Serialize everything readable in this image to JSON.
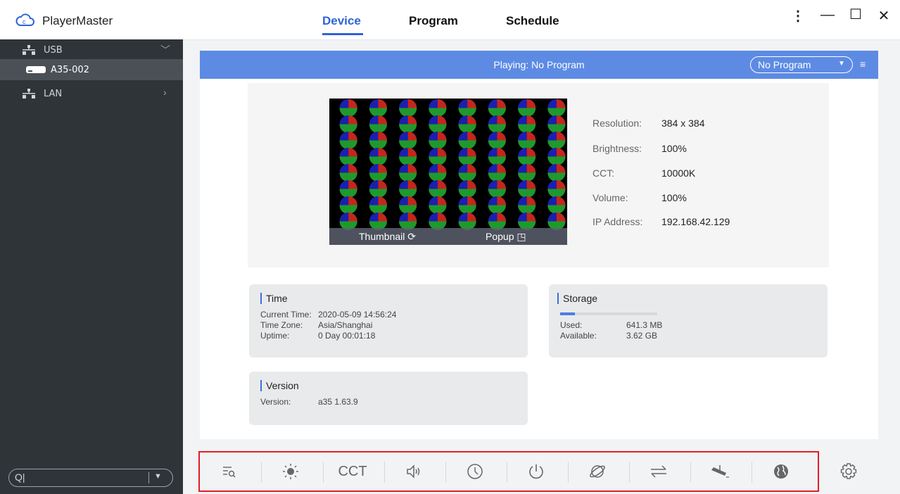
{
  "app": {
    "title": "PlayerMaster",
    "tabs": [
      {
        "label": "Device",
        "active": true
      },
      {
        "label": "Program",
        "active": false
      },
      {
        "label": "Schedule",
        "active": false
      }
    ],
    "window_controls": [
      "more-vert-icon",
      "minimize-icon",
      "maximize-icon",
      "close-icon"
    ],
    "accent_color": "#2e63d8"
  },
  "sidebar": {
    "items": [
      {
        "label": "USB",
        "icon": "network-icon",
        "expanded": true
      },
      {
        "label": "A35-002",
        "icon": "device-icon",
        "selected": true
      },
      {
        "label": "LAN",
        "icon": "network-icon",
        "expanded": false
      }
    ],
    "search": {
      "value": "",
      "icon": "search-icon"
    }
  },
  "status": {
    "playing": "Playing: No Program",
    "program_select": "No Program",
    "bar_color": "#5d8be4"
  },
  "preview": {
    "thumbnail_label": "Thumbnail",
    "popup_label": "Popup"
  },
  "device_info": [
    {
      "label": "Resolution:",
      "value": "384 x 384"
    },
    {
      "label": "Brightness:",
      "value": "100%"
    },
    {
      "label": "CCT:",
      "value": "10000K"
    },
    {
      "label": "Volume:",
      "value": "100%"
    },
    {
      "label": "IP Address:",
      "value": "192.168.42.129"
    }
  ],
  "time": {
    "title": "Time",
    "rows": [
      {
        "label": "Current Time:",
        "value": "2020-05-09 14:56:24"
      },
      {
        "label": "Time Zone:",
        "value": "Asia/Shanghai"
      },
      {
        "label": "Uptime:",
        "value": "0 Day 00:01:18"
      }
    ]
  },
  "storage": {
    "title": "Storage",
    "used_fraction": 0.15,
    "rows": [
      {
        "label": "Used:",
        "value": "641.3 MB"
      },
      {
        "label": "Available:",
        "value": "3.62 GB"
      }
    ]
  },
  "version": {
    "title": "Version",
    "rows": [
      {
        "label": "Version:",
        "value": "a35 1.63.9"
      }
    ]
  },
  "toolbar": {
    "cct_label": "CCT",
    "tools": [
      "list-search-icon",
      "brightness-icon",
      "cct-icon",
      "volume-icon",
      "clock-icon",
      "power-icon",
      "planet-icon",
      "swap-icon",
      "wall-mount-icon",
      "globe-icon",
      "settings-icon"
    ]
  }
}
